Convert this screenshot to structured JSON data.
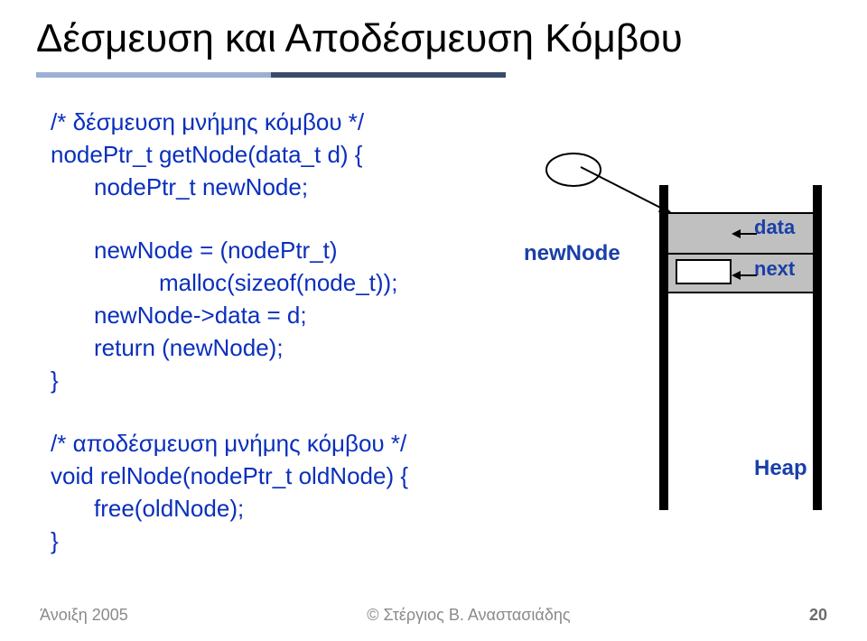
{
  "title": "Δέσμευση και Αποδέσμευση Κόμβου",
  "code": {
    "comment_alloc": "/* δέσμευση μνήμης κόμβου */",
    "fn_sig": "nodePtr_t getNode(data_t d) {",
    "decl": "nodePtr_t newNode;",
    "assign1": "newNode = (nodePtr_t)",
    "assign2": "malloc(sizeof(node_t));",
    "assign3": "newNode->data = d;",
    "ret": "return (newNode);",
    "close1": "}",
    "comment_free": "/* αποδέσμευση μνήμης κόμβου */",
    "fn2_sig": "void relNode(nodePtr_t oldNode) {",
    "free_call": "free(oldNode);",
    "close2": "}"
  },
  "labels": {
    "newNode": "newNode",
    "data": "data",
    "next": "next",
    "heap": "Heap"
  },
  "footer": {
    "left": "Άνοιξη 2005",
    "center": "© Στέργιος Β. Αναστασιάδης",
    "page": "20"
  }
}
